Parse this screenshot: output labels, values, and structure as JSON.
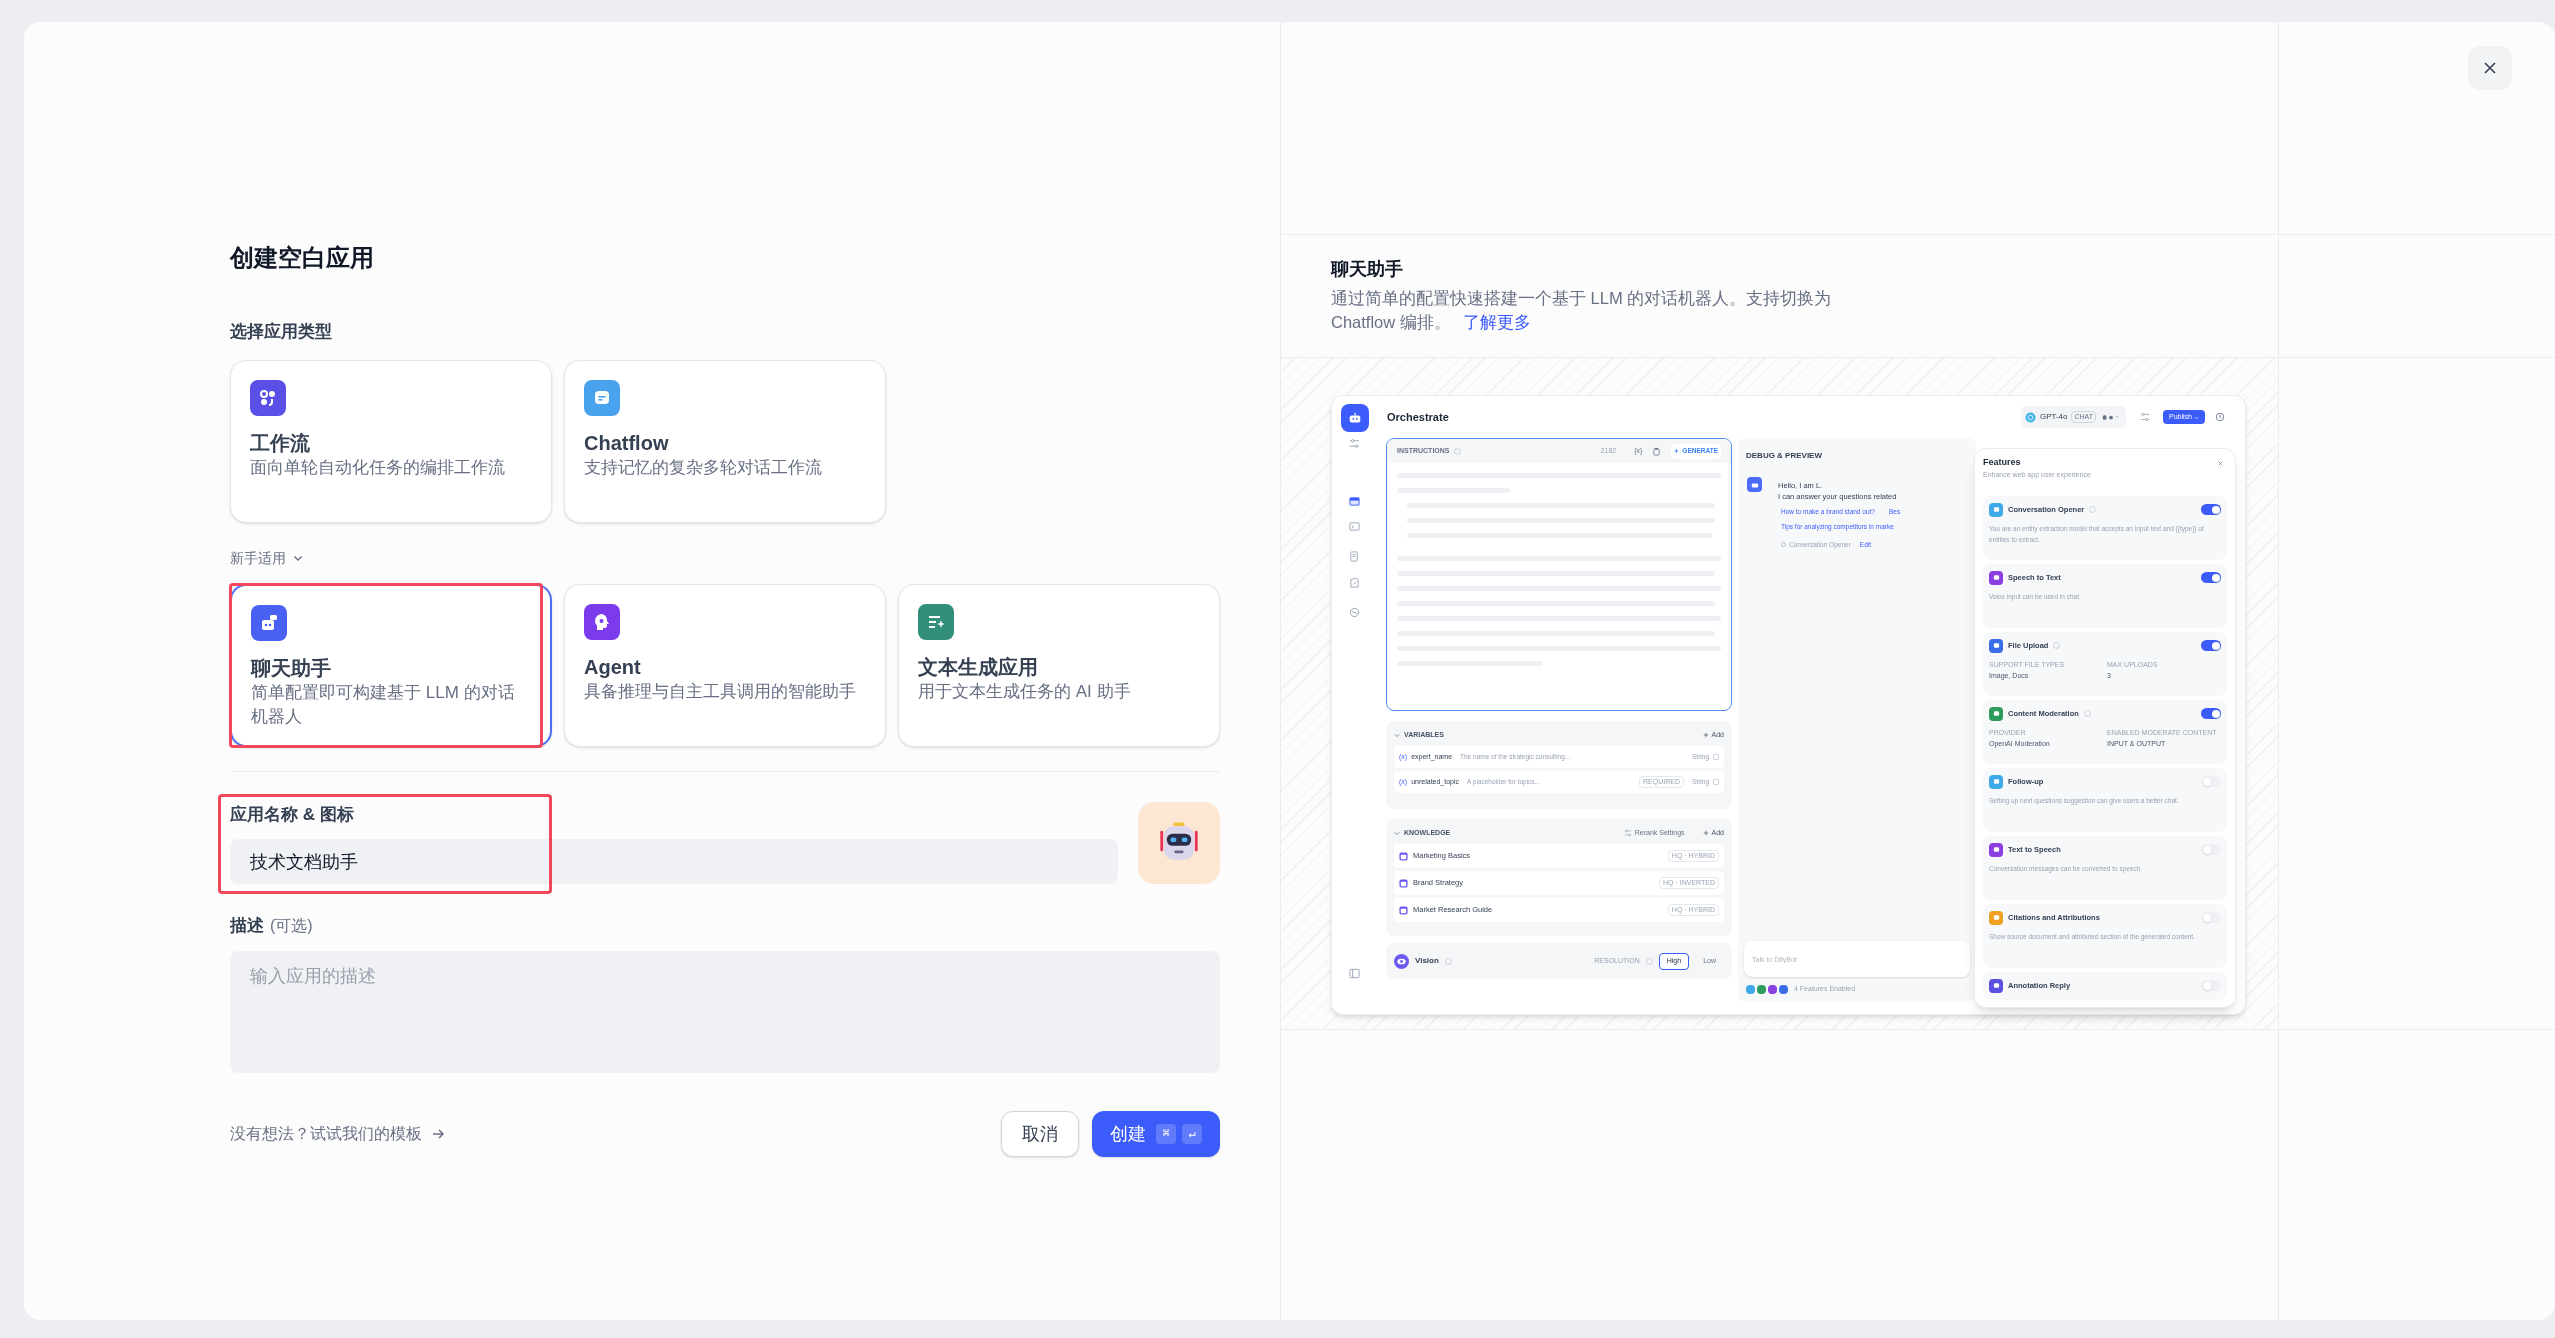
{
  "dialog": {
    "title": "创建空白应用",
    "type_label": "选择应用类型",
    "app_types": [
      {
        "kind": "workflow",
        "title": "工作流",
        "description": "面向单轮自动化任务的编排工作流",
        "color": "#5a4fe6",
        "selected": false,
        "highlighted": false
      },
      {
        "kind": "chatflow",
        "title": "Chatflow",
        "description": "支持记忆的复杂多轮对话工作流",
        "color": "#49a2ee",
        "selected": false,
        "highlighted": false
      }
    ],
    "beginner_label": "新手适用",
    "beginner_types": [
      {
        "kind": "chat",
        "title": "聊天助手",
        "description": "简单配置即可构建基于 LLM 的对话机器人",
        "color": "#4961f0",
        "selected": true,
        "highlighted": true
      },
      {
        "kind": "agent",
        "title": "Agent",
        "description": "具备推理与自主工具调用的智能助手",
        "color": "#7c3aed",
        "selected": false,
        "highlighted": false
      },
      {
        "kind": "text",
        "title": "文本生成应用",
        "description": "用于文本生成任务的 AI 助手",
        "color": "#32907a",
        "selected": false,
        "highlighted": false
      }
    ],
    "name_label": "应用名称 & 图标",
    "name_value": "技术文档助手",
    "name_highlighted": true,
    "description_label": "描述",
    "description_optional": "(可选)",
    "description_placeholder": "输入应用的描述",
    "template_link": "没有想法？试试我们的模板",
    "cancel": "取消",
    "create": "创建",
    "create_keys": [
      "⌘",
      "↵"
    ]
  },
  "preview": {
    "title": "聊天助手",
    "description": "通过简单的配置快速搭建一个基于 LLM 的对话机器人。支持切换为 Chatflow 编排。",
    "link": "了解更多",
    "screenshot": {
      "orchestrate_title": "Orchestrate",
      "model": {
        "name": "GPT-4o",
        "mode": "CHAT"
      },
      "publish": "Publish",
      "instructions": {
        "label": "INSTRUCTIONS",
        "count": "2182",
        "variable_token": "{x}",
        "generate": "GENERATE"
      },
      "variables": {
        "label": "VARIABLES",
        "add": "Add",
        "items": [
          {
            "token": "(x)",
            "name": "expert_name",
            "description": "The name of the strategic consulting...",
            "type": "String"
          },
          {
            "token": "(x)",
            "name": "unrelated_topic",
            "description": "A placeholder for topics...",
            "badge": "REQUIRED",
            "type": "String"
          }
        ]
      },
      "knowledge": {
        "label": "KNOWLEDGE",
        "rerank": "Rerank Settings",
        "add": "Add",
        "items": [
          {
            "name": "Marketing Basics",
            "mode": "HQ · HYBRID"
          },
          {
            "name": "Brand Strategy",
            "mode": "HQ · INVERTED"
          },
          {
            "name": "Market Research Guide",
            "mode": "HQ · HYBRID"
          }
        ]
      },
      "vision": {
        "label": "Vision",
        "resolution_label": "RESOLUTION",
        "options": [
          {
            "label": "High",
            "selected": true
          },
          {
            "label": "Low",
            "selected": false
          }
        ]
      },
      "debug": {
        "title": "DEBUG & PREVIEW",
        "greeting": [
          "Hello, I am L.",
          "I can answer your questions related"
        ],
        "suggestion_rows": [
          [
            "How to make a brand stand out?",
            "Bes"
          ],
          [
            "Tips for analyzing competitors in marke"
          ]
        ],
        "opener_label": "Conversation Opener",
        "edit": "Edit",
        "input_placeholder": "Talk to DifyBot",
        "enabled_icons": [
          {
            "color": "#3fa8e8"
          },
          {
            "color": "#2e9a5e"
          },
          {
            "color": "#8b3fe0"
          },
          {
            "color": "#3b6ce8"
          }
        ],
        "features_enabled": "4 Features Enabled"
      },
      "features": {
        "title": "Features",
        "subtitle": "Enhance web app user experience",
        "items": [
          {
            "kind": "text",
            "title": "Conversation Opener",
            "help": true,
            "on": true,
            "color": "#3fa8e8",
            "description": "You are an entity extraction model that accepts an input text and {{type}} of entities to extract."
          },
          {
            "kind": "text",
            "title": "Speech to Text",
            "help": false,
            "on": true,
            "color": "#8b3fe0",
            "description": "Voice input can be used in chat."
          },
          {
            "kind": "fields",
            "title": "File Upload",
            "help": true,
            "on": true,
            "color": "#3b6ce8",
            "fields": [
              {
                "label": "SUPPORT FILE TYPES",
                "value": "Image, Docs"
              },
              {
                "label": "MAX UPLOADS",
                "value": "3"
              }
            ]
          },
          {
            "kind": "fields",
            "title": "Content Moderation",
            "help": true,
            "on": true,
            "color": "#2e9a5e",
            "fields": [
              {
                "label": "PROVIDER",
                "value": "OpenAI Moderation"
              },
              {
                "label": "ENABLED MODERATE CONTENT",
                "value": "INPUT & OUTPUT"
              }
            ]
          },
          {
            "kind": "text",
            "title": "Follow-up",
            "help": false,
            "on": false,
            "color": "#3fa8e8",
            "description": "Setting up next questions suggestion can give users a better chat."
          },
          {
            "kind": "text",
            "title": "Text to Speech",
            "help": false,
            "on": false,
            "color": "#8b3fe0",
            "description": "Conversation messages can be converted to speech."
          },
          {
            "kind": "text",
            "title": "Citations and Attributions",
            "help": false,
            "on": false,
            "color": "#f0a020",
            "description": "Show source document and attributed section of the generated content."
          },
          {
            "kind": "title",
            "title": "Annotation Reply",
            "help": false,
            "on": false,
            "color": "#5b4fe0"
          }
        ]
      }
    }
  }
}
